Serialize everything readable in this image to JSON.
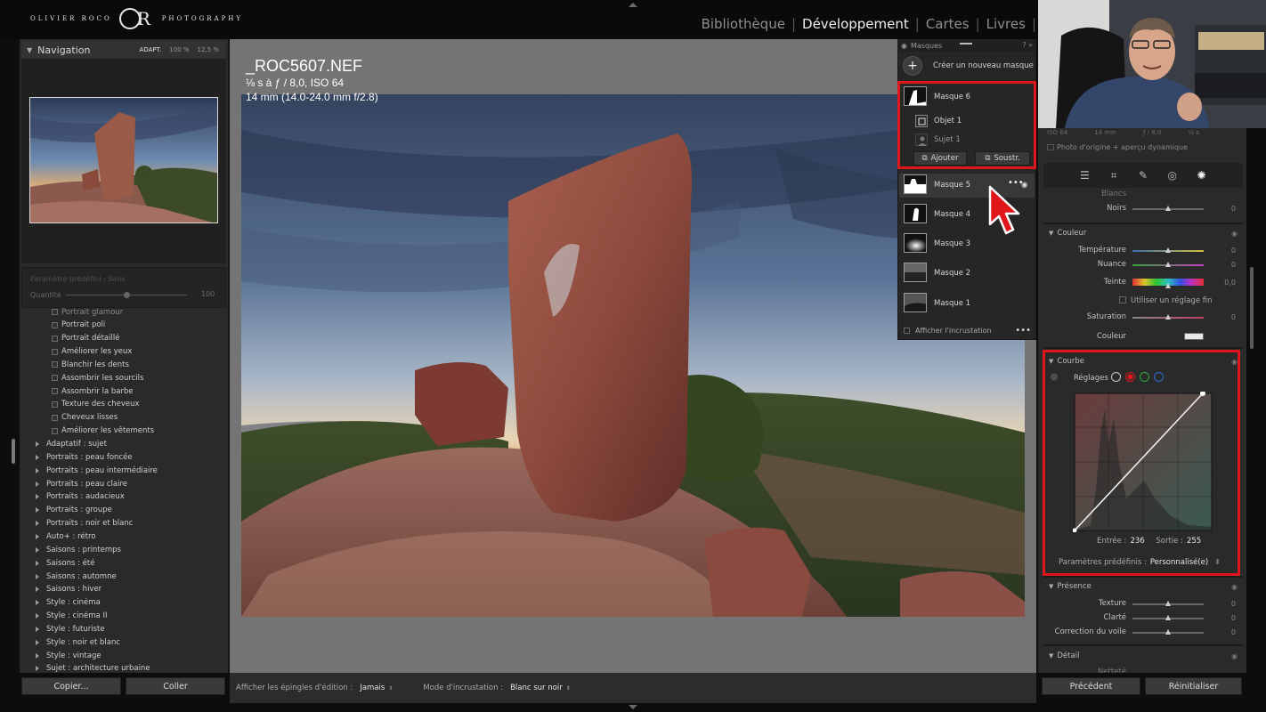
{
  "logo": {
    "left": "OLIVIER ROCO",
    "right": "PHOTOGRAPHY",
    "lettering": "OR"
  },
  "modules": [
    "Bibliothèque",
    "Développement",
    "Cartes",
    "Livres"
  ],
  "active_module": "Développement",
  "navigator": {
    "title": "Navigation",
    "zoom": [
      "ADAPT.",
      "100 %",
      "12,5 %"
    ]
  },
  "preset_amount": {
    "preset_label": "Paramètre prédéfini : Sans",
    "quantity_label": "Quantité",
    "quantity_value": "100",
    "quantity_level": 0.5
  },
  "presets": {
    "sub_items": [
      "Portrait glamour",
      "Portrait poli",
      "Portrait détaillé",
      "Améliorer les yeux",
      "Blanchir les dents",
      "Assombrir les sourcils",
      "Assombrir la barbe",
      "Texture des cheveux",
      "Cheveux lisses",
      "Améliorer les vêtements"
    ],
    "groups": [
      "Adaptatif : sujet",
      "Portraits : peau foncée",
      "Portraits : peau intermédiaire",
      "Portraits : peau claire",
      "Portraits : audacieux",
      "Portraits : groupe",
      "Portraits : noir et blanc",
      "Auto+ : rétro",
      "Saisons : printemps",
      "Saisons : été",
      "Saisons : automne",
      "Saisons : hiver",
      "Style : cinéma",
      "Style : cinéma II",
      "Style : futuriste",
      "Style : noir et blanc",
      "Style : vintage",
      "Sujet : architecture urbaine"
    ]
  },
  "left_buttons": {
    "copy": "Copier...",
    "paste": "Coller"
  },
  "photo_info": {
    "filename": "_ROC5607.NEF",
    "exposure": "⅛ s à ƒ / 8,0, ISO 64",
    "lens": "14 mm (14.0-24.0 mm f/2.8)"
  },
  "toolbar": {
    "pins_label": "Afficher les épingles d'édition :",
    "pins_value": "Jamais",
    "overlay_label": "Mode d'incrustation :",
    "overlay_value": "Blanc sur noir"
  },
  "masks_panel": {
    "title": "Masques",
    "create": "Créer un nouveau masque",
    "mask6": "Masque 6",
    "components": [
      "Objet 1",
      "Sujet 1"
    ],
    "add": "Ajouter",
    "subtract": "Soustr.",
    "masks": [
      "Masque 5",
      "Masque 4",
      "Masque 3",
      "Masque 2",
      "Masque 1"
    ],
    "show_overlay": "Afficher l'incrustation"
  },
  "histogram_info": {
    "iso": "ISO 64",
    "focal": "14 mm",
    "aperture": "ƒ / 8,0",
    "shutter": "⅛ s"
  },
  "original_preview": "Photo d'origine + aperçu dynamique",
  "basic_partial": {
    "blancs": "Blancs",
    "noirs": "Noirs",
    "noirs_value": "0"
  },
  "color_section": {
    "title": "Couleur",
    "sliders": [
      {
        "label": "Température",
        "value": "0",
        "level": 0.5
      },
      {
        "label": "Nuance",
        "value": "0",
        "level": 0.5
      },
      {
        "label": "Teinte",
        "value": "0,0",
        "level": 0.5
      }
    ],
    "fine_adjust": "Utiliser un réglage fin",
    "saturation": {
      "label": "Saturation",
      "value": "0",
      "level": 0.5
    },
    "couleur_label": "Couleur"
  },
  "curve_section": {
    "title": "Courbe",
    "reglages": "Réglages",
    "channel_colors": [
      "#cccccc",
      "#e0171a",
      "#2faa3a",
      "#2a6bd8"
    ],
    "input_label": "Entrée :",
    "input_value": "236",
    "output_label": "Sortie :",
    "output_value": "255",
    "preset_label": "Paramètres prédéfinis :",
    "preset_value": "Personnalisé(e)"
  },
  "presence_section": {
    "title": "Présence",
    "sliders": [
      {
        "label": "Texture",
        "value": "0",
        "level": 0.5
      },
      {
        "label": "Clarté",
        "value": "0",
        "level": 0.5
      },
      {
        "label": "Correction du voile",
        "value": "0",
        "level": 0.5
      }
    ]
  },
  "detail_section": {
    "title": "Détail",
    "first_item": "Netteté"
  },
  "right_buttons": {
    "previous": "Précédent",
    "reset": "Réinitialiser"
  },
  "colors": {
    "highlight": "#e0171a",
    "panel": "#2a2a2a",
    "background": "#747474"
  }
}
